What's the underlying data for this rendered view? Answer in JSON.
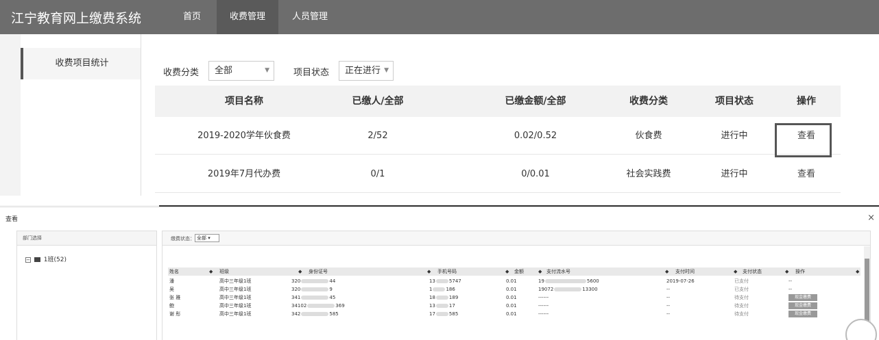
{
  "app": {
    "title": "江宁教育网上缴费系统"
  },
  "nav": [
    {
      "label": "首页",
      "active": false
    },
    {
      "label": "收费管理",
      "active": true
    },
    {
      "label": "人员管理",
      "active": false
    }
  ],
  "sidebar": {
    "items": [
      {
        "label": "收费项目统计"
      }
    ]
  },
  "filters": {
    "category_label": "收费分类",
    "category_value": "全部",
    "status_label": "项目状态",
    "status_value": "正在进行"
  },
  "table": {
    "headers": [
      "项目名称",
      "已缴人/全部",
      "已缴金额/全部",
      "收费分类",
      "项目状态",
      "操作"
    ],
    "rows": [
      {
        "name": "2019-2020学年伙食费",
        "paid_count": "2/52",
        "paid_amount": "0.02/0.52",
        "category": "伙食费",
        "status": "进行中",
        "action": "查看"
      },
      {
        "name": "2019年7月代办费",
        "paid_count": "0/1",
        "paid_amount": "0/0.01",
        "category": "社会实践费",
        "status": "进行中",
        "action": "查看"
      }
    ]
  },
  "dialog": {
    "title": "查看",
    "close": "×",
    "dept_header": "部门选择",
    "tree": {
      "toggle": "−",
      "label": "1班(52)"
    },
    "status_filter_label": "缴费状态：",
    "status_filter_value": "全部",
    "columns": [
      "姓名",
      "班级",
      "身份证号",
      "手机号码",
      "金额",
      "支付流水号",
      "支付时间",
      "支付状态",
      "操作"
    ],
    "rows": [
      {
        "name": "潘",
        "class": "高中三年级1班",
        "id_a": "320",
        "id_b": "44",
        "phone_a": "13",
        "phone_b": "5747",
        "amount": "0.01",
        "serial_a": "19",
        "serial_b": "5600",
        "time": "2019-07-26",
        "pay_status": "已支付",
        "action": "--",
        "button": false
      },
      {
        "name": "吴",
        "class": "高中三年级1班",
        "id_a": "320",
        "id_b": "9",
        "phone_a": "1",
        "phone_b": "186",
        "amount": "0.01",
        "serial_a": "19072",
        "serial_b": "13300",
        "time": "--",
        "pay_status": "已支付",
        "action": "--",
        "button": false
      },
      {
        "name": "张 雅",
        "class": "高中三年级1班",
        "id_a": "341",
        "id_b": "45",
        "phone_a": "18",
        "phone_b": "189",
        "amount": "0.01",
        "serial_a": "------",
        "serial_b": "",
        "time": "--",
        "pay_status": "待支付",
        "action": "现金缴费",
        "button": true
      },
      {
        "name": "鲍",
        "class": "高中三年级1班",
        "id_a": "34102",
        "id_b": "369",
        "phone_a": "13",
        "phone_b": "17",
        "amount": "0.01",
        "serial_a": "------",
        "serial_b": "",
        "time": "--",
        "pay_status": "待支付",
        "action": "现金缴费",
        "button": true
      },
      {
        "name": "谢 彤",
        "class": "高中三年级1班",
        "id_a": "342",
        "id_b": "585",
        "phone_a": "17",
        "phone_b": "585",
        "amount": "0.01",
        "serial_a": "------",
        "serial_b": "",
        "time": "--",
        "pay_status": "待支付",
        "action": "现金缴费",
        "button": true
      }
    ]
  }
}
